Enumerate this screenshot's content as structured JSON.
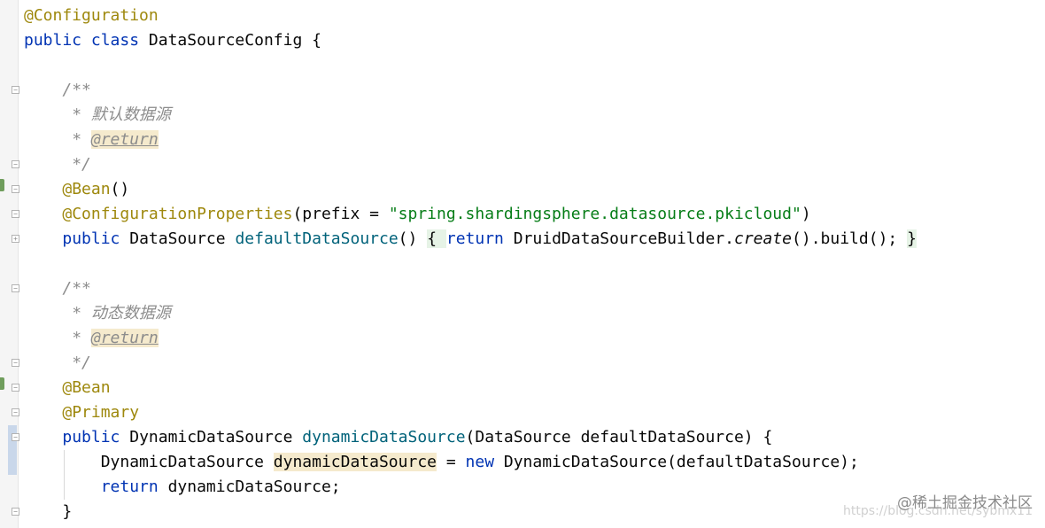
{
  "editor": {
    "lines": [
      {
        "key": "l1",
        "tokens": [
          {
            "t": "@Configuration",
            "c": "ann"
          }
        ]
      },
      {
        "key": "l2",
        "tokens": [
          {
            "t": "public",
            "c": "kw"
          },
          {
            "t": " "
          },
          {
            "t": "class",
            "c": "kw"
          },
          {
            "t": " DataSourceConfig {"
          }
        ]
      },
      {
        "key": "l3",
        "tokens": []
      },
      {
        "key": "l4",
        "tokens": [
          {
            "t": "    "
          },
          {
            "t": "/**",
            "c": "cm"
          }
        ]
      },
      {
        "key": "l5",
        "tokens": [
          {
            "t": "     "
          },
          {
            "t": "* 默认数据源",
            "c": "cm"
          }
        ]
      },
      {
        "key": "l6",
        "tokens": [
          {
            "t": "     "
          },
          {
            "t": "* ",
            "c": "cm"
          },
          {
            "t": "@return",
            "c": "tag"
          }
        ]
      },
      {
        "key": "l7",
        "tokens": [
          {
            "t": "     "
          },
          {
            "t": "*/",
            "c": "cm"
          }
        ]
      },
      {
        "key": "l8",
        "tokens": [
          {
            "t": "    "
          },
          {
            "t": "@Bean",
            "c": "ann"
          },
          {
            "t": "()"
          }
        ]
      },
      {
        "key": "l9",
        "tokens": [
          {
            "t": "    "
          },
          {
            "t": "@ConfigurationProperties",
            "c": "ann"
          },
          {
            "t": "(prefix = "
          },
          {
            "t": "\"spring.shardingsphere.datasource.pkicloud\"",
            "c": "str"
          },
          {
            "t": ")"
          }
        ]
      },
      {
        "key": "l10",
        "tokens": [
          {
            "t": "    "
          },
          {
            "t": "public",
            "c": "kw"
          },
          {
            "t": " DataSource "
          },
          {
            "t": "defaultDataSource",
            "c": "fn"
          },
          {
            "t": "() "
          },
          {
            "t": "{ ",
            "c": "br"
          },
          {
            "t": "return",
            "c": "kw"
          },
          {
            "t": " DruidDataSourceBuilder."
          },
          {
            "t": "create",
            "c": "ital"
          },
          {
            "t": "().build(); "
          },
          {
            "t": "}",
            "c": "br"
          }
        ]
      },
      {
        "key": "l11",
        "tokens": []
      },
      {
        "key": "l12",
        "tokens": [
          {
            "t": "    "
          },
          {
            "t": "/**",
            "c": "cm"
          }
        ]
      },
      {
        "key": "l13",
        "tokens": [
          {
            "t": "     "
          },
          {
            "t": "* 动态数据源",
            "c": "cm"
          }
        ]
      },
      {
        "key": "l14",
        "tokens": [
          {
            "t": "     "
          },
          {
            "t": "* ",
            "c": "cm"
          },
          {
            "t": "@return",
            "c": "tag"
          }
        ]
      },
      {
        "key": "l15",
        "tokens": [
          {
            "t": "     "
          },
          {
            "t": "*/",
            "c": "cm"
          }
        ]
      },
      {
        "key": "l16",
        "tokens": [
          {
            "t": "    "
          },
          {
            "t": "@Bean",
            "c": "ann"
          }
        ]
      },
      {
        "key": "l17",
        "tokens": [
          {
            "t": "    "
          },
          {
            "t": "@Primary",
            "c": "ann"
          }
        ]
      },
      {
        "key": "l18",
        "tokens": [
          {
            "t": "    "
          },
          {
            "t": "public",
            "c": "kw"
          },
          {
            "t": " DynamicDataSource "
          },
          {
            "t": "dynamicDataSource",
            "c": "fn"
          },
          {
            "t": "(DataSource defaultDataSource) {"
          }
        ]
      },
      {
        "key": "l19",
        "tokens": [
          {
            "t": "        DynamicDataSource "
          },
          {
            "t": "dynamicDataSource",
            "c": "hl"
          },
          {
            "t": " = "
          },
          {
            "t": "new",
            "c": "kw"
          },
          {
            "t": " DynamicDataSource(defaultDataSource);"
          }
        ]
      },
      {
        "key": "l20",
        "tokens": [
          {
            "t": "        "
          },
          {
            "t": "return",
            "c": "kw"
          },
          {
            "t": " dynamicDataSource;"
          }
        ]
      },
      {
        "key": "l21",
        "tokens": [
          {
            "t": "    }"
          }
        ]
      }
    ]
  },
  "watermark": {
    "primary": "@稀土掘金技术社区",
    "secondary": "https://blog.csdn.net/sybmx11"
  }
}
